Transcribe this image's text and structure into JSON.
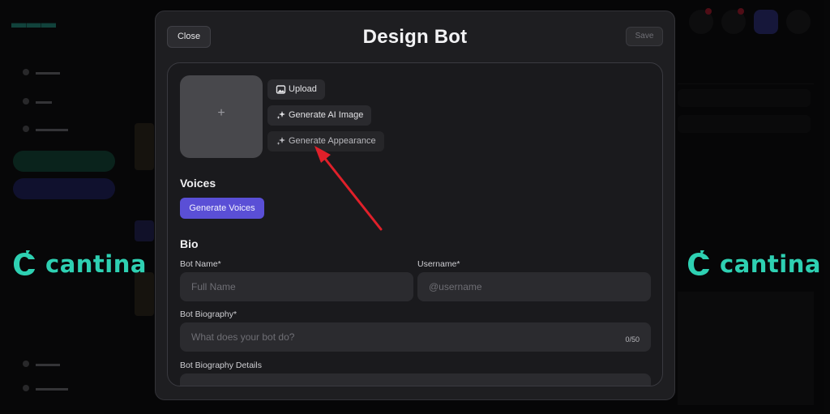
{
  "modal": {
    "title": "Design Bot",
    "close_label": "Close",
    "save_label": "Save"
  },
  "avatar": {
    "placeholder_glyph": "+"
  },
  "image_actions": [
    {
      "label": "Upload",
      "icon": "image-icon"
    },
    {
      "label": "Generate AI Image",
      "icon": "sparkle-icon"
    },
    {
      "label": "Generate Appearance",
      "icon": "sparkle-icon"
    }
  ],
  "voices": {
    "heading": "Voices",
    "button_label": "Generate Voices"
  },
  "bio": {
    "heading": "Bio",
    "bot_name_label": "Bot Name*",
    "bot_name_placeholder": "Full Name",
    "username_label": "Username*",
    "username_placeholder": "@username",
    "biography_label": "Bot Biography*",
    "biography_placeholder": "What does your bot do?",
    "biography_counter": "0/50",
    "details_label": "Bot Biography Details"
  },
  "brand": {
    "name": "cantina"
  },
  "colors": {
    "accent": "#5a4fd6",
    "brand": "#2ed0b2",
    "annotation": "#e0202a"
  }
}
